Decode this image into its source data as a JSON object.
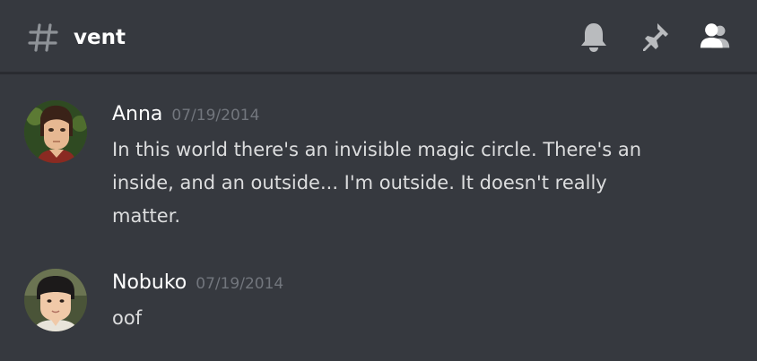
{
  "header": {
    "channel_icon": "hash-icon",
    "channel_name": "vent",
    "icons": [
      "bell-icon",
      "pin-icon",
      "members-icon"
    ]
  },
  "messages": [
    {
      "author": "Anna",
      "timestamp": "07/19/2014",
      "text": "In this world there's an invisible magic circle. There's an inside, and an outside... I'm outside. It doesn't really matter."
    },
    {
      "author": "Nobuko",
      "timestamp": "07/19/2014",
      "text": "oof"
    }
  ],
  "colors": {
    "background": "#36393f",
    "header_border": "#2a2c31",
    "username": "#ffffff",
    "timestamp": "#72767d",
    "message_text": "#dcddde",
    "icon": "#b9bbbe"
  }
}
